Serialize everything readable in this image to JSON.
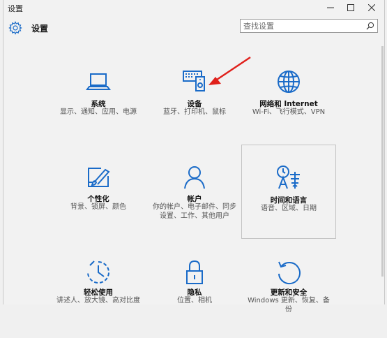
{
  "window": {
    "title": "设置",
    "controls": [
      "minimize",
      "maximize",
      "close"
    ]
  },
  "header": {
    "app_name": "设置",
    "search_placeholder": "查找设置"
  },
  "colors": {
    "accent": "#1a6bc8",
    "annotation_arrow": "#e0201b"
  },
  "tiles": [
    {
      "id": "system",
      "name": "系统",
      "desc": "显示、通知、应用、电源",
      "icon": "laptop-icon"
    },
    {
      "id": "devices",
      "name": "设备",
      "desc": "蓝牙、打印机、鼠标",
      "icon": "devices-icon"
    },
    {
      "id": "network",
      "name": "网络和 Internet",
      "desc": "Wi-Fi、飞行模式、VPN",
      "icon": "globe-icon"
    },
    {
      "id": "personalization",
      "name": "个性化",
      "desc": "背景、锁屏、颜色",
      "icon": "paintbrush-icon"
    },
    {
      "id": "accounts",
      "name": "帐户",
      "desc": "你的帐户、电子邮件、同步设置、工作、其他用户",
      "icon": "person-icon"
    },
    {
      "id": "time_language",
      "name": "时间和语言",
      "desc": "语音、区域、日期",
      "icon": "time-language-icon"
    },
    {
      "id": "ease_of_access",
      "name": "轻松使用",
      "desc": "讲述人、放大镜、高对比度",
      "icon": "ease-of-access-icon"
    },
    {
      "id": "privacy",
      "name": "隐私",
      "desc": "位置、相机",
      "icon": "lock-icon"
    },
    {
      "id": "update_security",
      "name": "更新和安全",
      "desc": "Windows 更新、恢复、备份",
      "icon": "update-icon"
    }
  ]
}
